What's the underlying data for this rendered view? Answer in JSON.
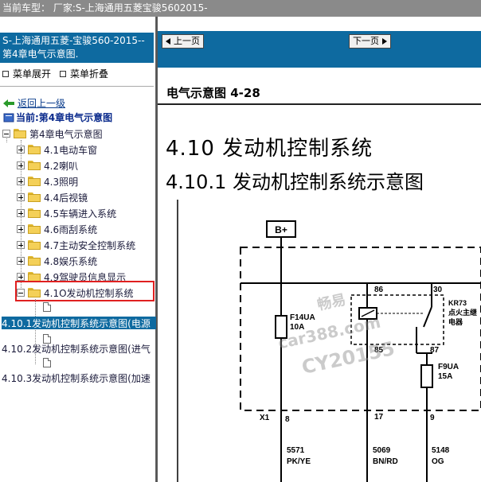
{
  "topbar": {
    "text": "当前车型： 厂家:S-上海通用五菱宝骏5602015-"
  },
  "left": {
    "title": "S-上海通用五菱-宝骏560-2015-- 第4章电气示意图.",
    "menu_expand": "菜单展开",
    "menu_collapse": "菜单折叠",
    "back_link": "返回上一级",
    "current_label": "当前:第4章电气示意图",
    "tree": {
      "root": "第4章电气示意图",
      "items": [
        "4.1电动车窗",
        "4.2喇叭",
        "4.3照明",
        "4.4后视镜",
        "4.5车辆进入系统",
        "4.6雨刮系统",
        "4.7主动安全控制系统",
        "4.8娱乐系统",
        "4.9驾驶员信息显示",
        "4.1O发动机控制系统"
      ],
      "subitems": [
        "4.10.1发动机控制系统示意图(电源",
        "4.10.2发动机控制系统示意图(进气",
        "4.10.3发动机控制系统示意图(加速"
      ]
    }
  },
  "right": {
    "prev_page": "上一页",
    "next_page": "下一页",
    "diagram_title": "电气示意图 4-28",
    "heading1": "4.10 发动机控制系统",
    "heading2": "4.10.1 发动机控制系统示意图",
    "diagram": {
      "bplus": "B+",
      "pin86": "86",
      "pin30": "30",
      "pin85": "85",
      "pin87": "87",
      "relay_id": "KR73",
      "relay_desc1": "点火主继",
      "relay_desc2": "电器",
      "fuse1_id": "F14UA",
      "fuse1_rating": "10A",
      "fuse2_id": "F9UA",
      "fuse2_rating": "15A",
      "connector": "X1",
      "pin8": "8",
      "pin17": "17",
      "pin9": "9",
      "wire1_num": "5571",
      "wire1_color": "PK/YE",
      "wire2_num": "5069",
      "wire2_color": "BN/RD",
      "wire3_num": "5148",
      "wire3_color": "OG"
    },
    "watermark": {
      "line1": "畅易",
      "line2": "car388.com",
      "line3": "CY20155"
    }
  }
}
